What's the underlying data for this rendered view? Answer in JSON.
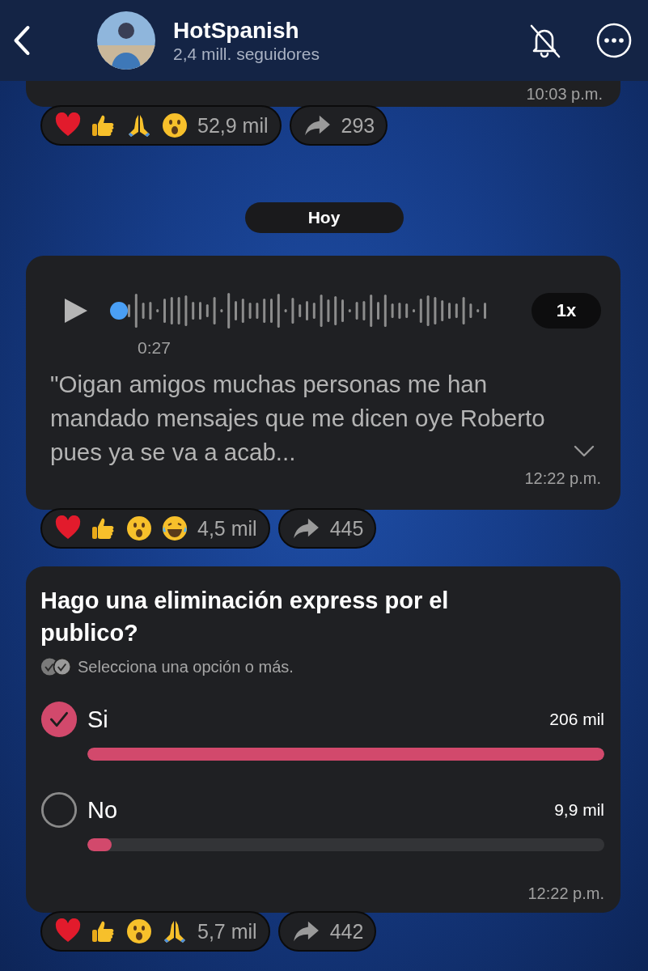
{
  "header": {
    "channel_name": "HotSpanish",
    "followers": "2,4 mill. seguidores"
  },
  "messages": [
    {
      "kind": "fragment",
      "time": "10:03 p.m.",
      "reactions": [
        {
          "kind": "heart"
        },
        {
          "kind": "thumbs"
        },
        {
          "kind": "pray"
        },
        {
          "kind": "wow"
        }
      ],
      "reaction_count": "52,9 mil",
      "shares": "293"
    },
    {
      "kind": "date",
      "label": "Hoy"
    },
    {
      "kind": "voice",
      "duration": "0:27",
      "speed": "1x",
      "transcript": "\"Oigan amigos muchas personas me han mandado mensajes que me dicen oye Roberto pues ya se va a acab...",
      "time": "12:22 p.m.",
      "reactions": [
        {
          "kind": "heart"
        },
        {
          "kind": "thumbs"
        },
        {
          "kind": "wow"
        },
        {
          "kind": "laugh"
        }
      ],
      "reaction_count": "4,5 mil",
      "shares": "445"
    },
    {
      "kind": "poll",
      "question": "Hago una eliminación express por el publico?",
      "hint": "Selecciona una opción o más.",
      "options": [
        {
          "label": "Si",
          "count": "206 mil",
          "selected": true,
          "level": 1
        },
        {
          "label": "No",
          "count": "9,9 mil",
          "selected": false,
          "level": 0.047
        }
      ],
      "time": "12:22 p.m.",
      "reactions": [
        {
          "kind": "heart"
        },
        {
          "kind": "thumbs"
        },
        {
          "kind": "wow"
        },
        {
          "kind": "pray"
        }
      ],
      "reaction_count": "5,7 mil",
      "shares": "442"
    }
  ]
}
